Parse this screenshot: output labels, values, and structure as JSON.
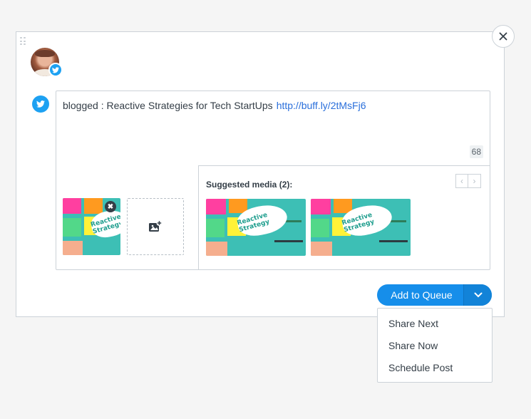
{
  "composer": {
    "post_text": "blogged : Reactive Strategies for Tech StartUps",
    "post_link": "http://buff.ly/2tMsFj6",
    "char_count": "68"
  },
  "attachment": {
    "remove_label": "✖",
    "image_caption": "Reactive Strategy"
  },
  "suggested_media": {
    "title": "Suggested media (2):",
    "items": [
      {
        "caption": "Reactive Strategy"
      },
      {
        "caption": "Reactive Strategy"
      }
    ],
    "prev_label": "‹",
    "next_label": "›"
  },
  "actions": {
    "add_to_queue": "Add to Queue",
    "dropdown_items": [
      "Share Next",
      "Share Now",
      "Schedule Post"
    ]
  },
  "colors": {
    "accent": "#168eea",
    "twitter": "#1da1f2",
    "link": "#2a6fdb"
  }
}
